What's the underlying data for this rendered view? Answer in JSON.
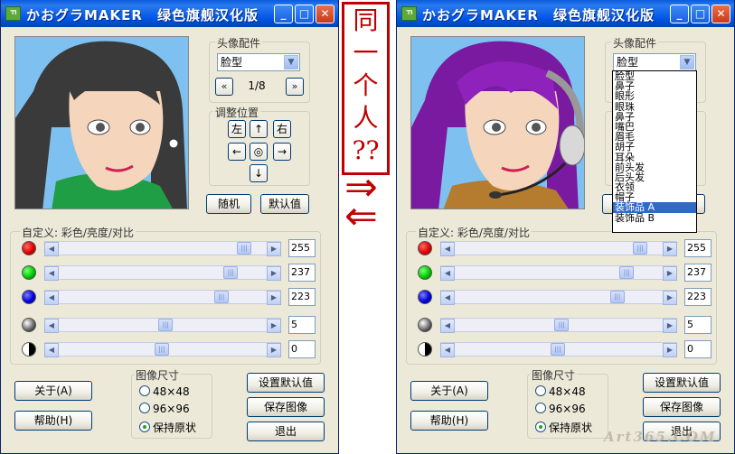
{
  "left_window": {
    "title": "かおグラMAKER　绿色旗舰汉化版",
    "groups": {
      "head_parts": "头像配件",
      "adjust": "调整位置",
      "custom": "自定义: 彩色/亮度/对比",
      "image_size": "图像尺寸"
    },
    "part_select": "脸型",
    "page": "1/8",
    "pad": {
      "left": "左",
      "right": "右",
      "up": "↑",
      "down": "↓",
      "arrow_left": "←",
      "arrow_right": "→",
      "center": "◎"
    },
    "buttons": {
      "random": "随机",
      "default": "默认值",
      "about": "关于(A)",
      "help": "帮助(H)",
      "set_default": "设置默认值",
      "save_image": "保存图像",
      "exit": "退出"
    },
    "sliders": [
      {
        "name": "red",
        "value": "255",
        "level": 0.93
      },
      {
        "name": "green",
        "value": "237",
        "level": 0.86
      },
      {
        "name": "blue",
        "value": "223",
        "level": 0.81
      },
      {
        "name": "brightness",
        "value": "5",
        "level": 0.52
      },
      {
        "name": "contrast",
        "value": "0",
        "level": 0.5
      }
    ],
    "size_options": [
      "48×48",
      "96×96",
      "保持原状"
    ],
    "size_selected": 2
  },
  "right_window": {
    "title": "かおグラMAKER　绿色旗舰汉化版",
    "groups": {
      "head_parts": "头像配件",
      "custom": "自定义: 彩色/亮度/对比",
      "image_size": "图像尺寸"
    },
    "part_select": "脸型",
    "buttons": {
      "about": "关于(A)",
      "help": "帮助(H)",
      "set_default": "设置默认值",
      "save_image": "保存图像",
      "exit": "退出"
    },
    "sliders": [
      {
        "name": "red",
        "value": "255",
        "level": 0.93
      },
      {
        "name": "green",
        "value": "237",
        "level": 0.86
      },
      {
        "name": "blue",
        "value": "223",
        "level": 0.81
      },
      {
        "name": "brightness",
        "value": "5",
        "level": 0.52
      },
      {
        "name": "contrast",
        "value": "0",
        "level": 0.5
      }
    ],
    "size_options": [
      "48×48",
      "96×96",
      "保持原状"
    ],
    "size_selected": 2,
    "dropdown_items": [
      "脸型",
      "鼻子",
      "眼形",
      "眼珠",
      "鼻子",
      "嘴巴",
      "眉毛",
      "胡子",
      "耳朵",
      "前头发",
      "后头发",
      "衣领",
      "帽子",
      "装饰品 A",
      "装饰品 B"
    ],
    "dropdown_selected": 13
  },
  "annotation": {
    "text_lines": [
      "同",
      "一",
      "个",
      "人",
      "??"
    ],
    "arrow_right": "⇒",
    "arrow_left": "⇐"
  },
  "watermark": "Art365.COM",
  "colors": {
    "title_blue": "#0055e5",
    "annotation_red": "#c00000",
    "dialog": "#ece9d8"
  }
}
